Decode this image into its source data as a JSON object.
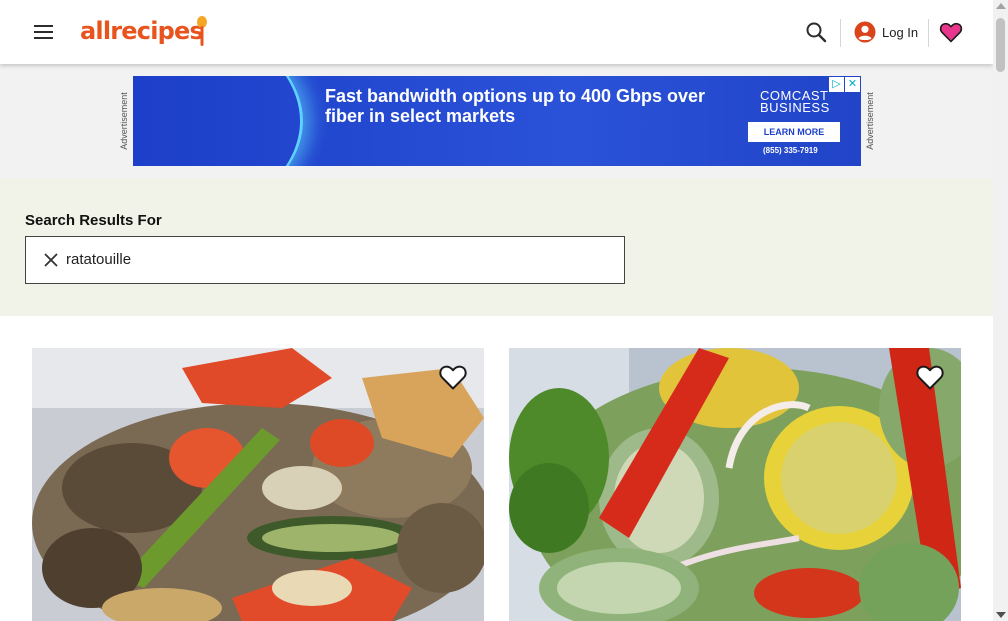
{
  "header": {
    "logo_text": "allrecipes",
    "menu_icon": "hamburger-menu-icon",
    "search_icon": "search-icon",
    "account_icon": "user-circle-icon",
    "login_label": "Log In",
    "saved_icon": "heart-icon",
    "brand_color": "#e9541e",
    "saved_color": "#e9368d"
  },
  "ad": {
    "label": "Advertisement",
    "headline": "Fast bandwidth options up to 400 Gbps over fiber in select markets",
    "brand_line1": "COMCAST",
    "brand_line2": "BUSINESS",
    "cta": "LEARN MORE",
    "phone": "(855) 335-7919",
    "adchoices_icon": "adchoices-icon",
    "close_icon": "close-icon",
    "background_color": "#1d3fc9"
  },
  "search": {
    "title": "Search Results For",
    "value": "ratatouille",
    "clear_icon": "close-icon"
  },
  "results": [
    {
      "image": "ratatouille-photo-1",
      "save_icon": "heart-outline-icon"
    },
    {
      "image": "ratatouille-photo-2",
      "save_icon": "heart-outline-icon"
    }
  ]
}
